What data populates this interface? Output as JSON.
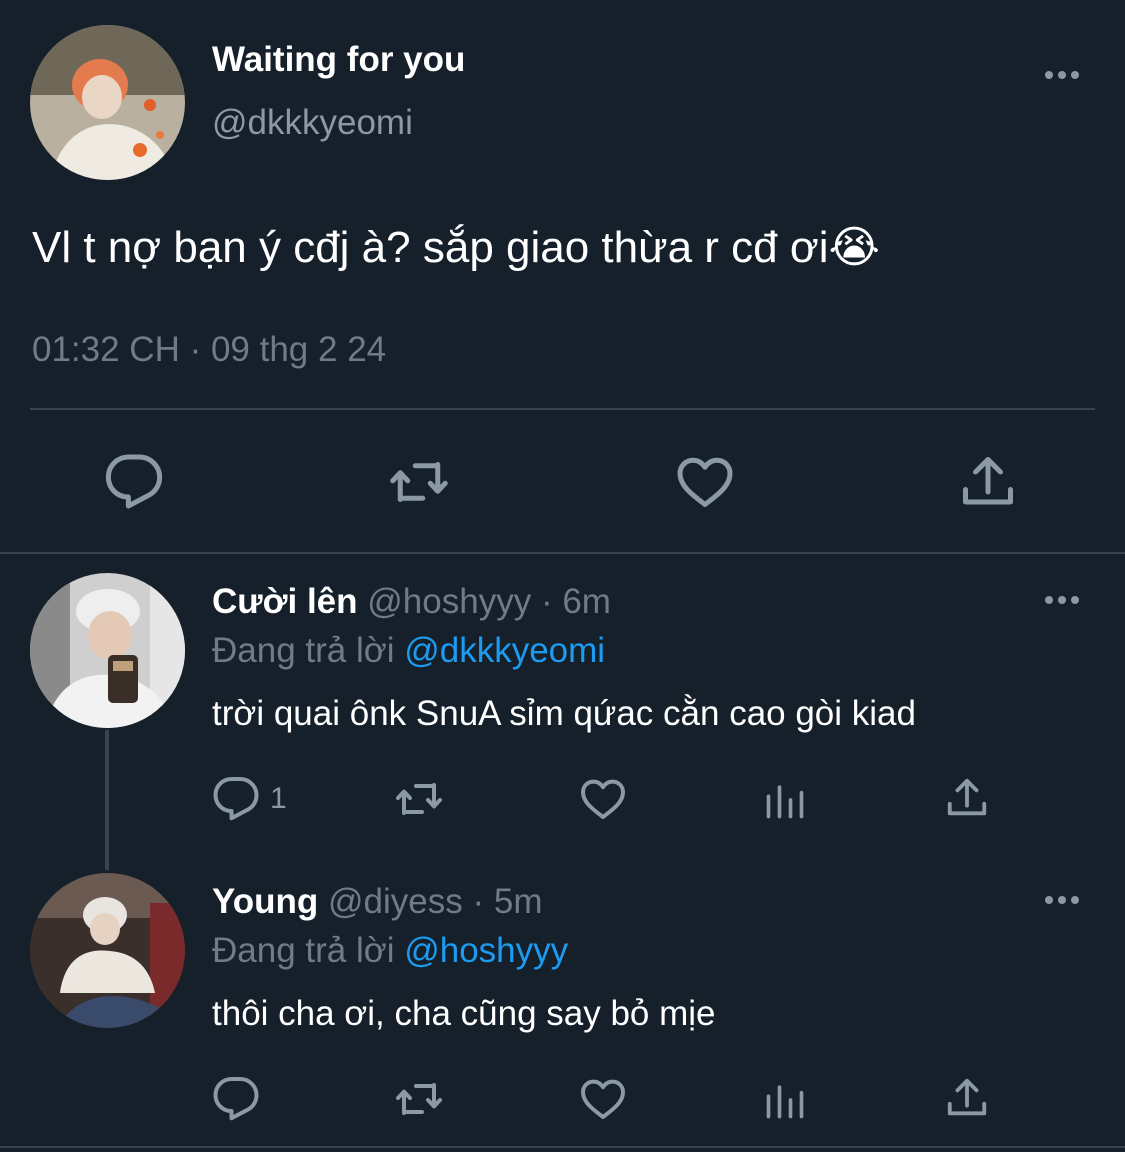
{
  "main_tweet": {
    "display_name": "Waiting for you",
    "handle": "@dkkkyeomi",
    "text": "Vl t nợ bạn ý cđj à? sắp giao thừa r cđ ơi😭",
    "meta": "01:32 CH · 09 thg 2 24",
    "actions": [
      "reply-icon",
      "retweet-icon",
      "like-icon",
      "share-icon"
    ]
  },
  "replies": [
    {
      "display_name": "Cười lên",
      "handle": "@hoshyyy",
      "time": "· 6m",
      "replying_label": "Đang trả lời",
      "replying_to": "@dkkkyeomi",
      "text": "trời quai ônk SnuA sỉm qứac cằn cao gòi kiad",
      "reply_count": "1"
    },
    {
      "display_name": "Young",
      "handle": "@diyess",
      "time": "· 5m",
      "replying_label": "Đang trả lời",
      "replying_to": "@hoshyyy",
      "text": "thôi cha ơi, cha cũng say bỏ mịe",
      "reply_count": ""
    }
  ],
  "colors": {
    "background": "#15202b",
    "secondary_text": "#8b98a5",
    "mention": "#1d9bf0",
    "divider": "#38444d"
  }
}
